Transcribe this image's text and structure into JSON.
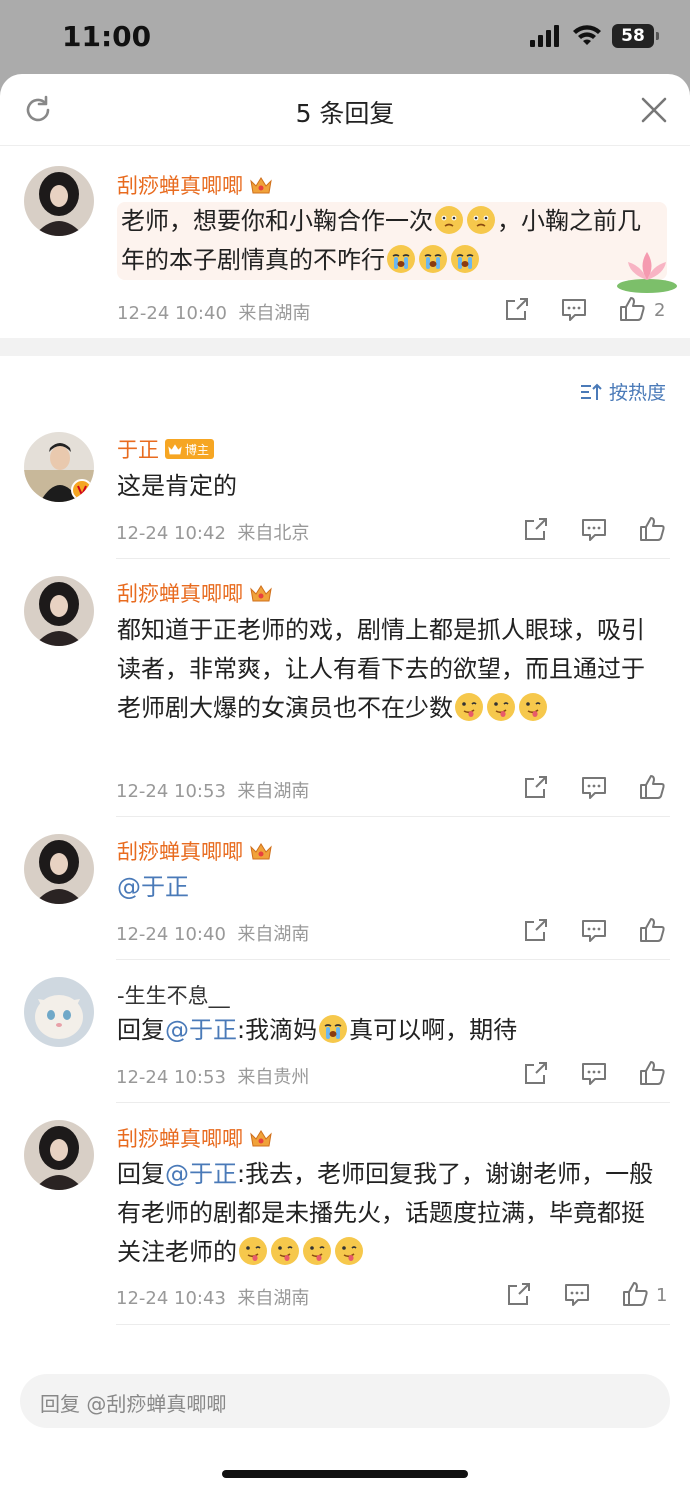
{
  "status": {
    "time": "11:00",
    "battery": "58"
  },
  "sheet": {
    "title": "5 条回复"
  },
  "original": {
    "author": "刮痧蝉真唧唧",
    "text_a": "老师，想要你和小鞠合作一次",
    "text_b": "，小鞠之前几年的本子剧情真的不咋行",
    "time": "12-24 10:40",
    "location": "来自湖南",
    "likes": "2"
  },
  "sort_label": "按热度",
  "replies": [
    {
      "author": "于正",
      "badge": "博主",
      "text": "这是肯定的",
      "time": "12-24 10:42",
      "location": "来自北京"
    },
    {
      "author": "刮痧蝉真唧唧",
      "text": "都知道于正老师的戏，剧情上都是抓人眼球，吸引读者，非常爽，让人有看下去的欲望，而且通过于老师剧大爆的女演员也不在少数",
      "time": "12-24 10:53",
      "location": "来自湖南"
    },
    {
      "author": "刮痧蝉真唧唧",
      "mention": "@于正",
      "time": "12-24 10:40",
      "location": "来自湖南"
    },
    {
      "author": "-生生不息__",
      "prefix": "回复",
      "mention": "@于正",
      "text_a": ":我滴妈",
      "text_b": "真可以啊，期待",
      "time": "12-24 10:53",
      "location": "来自贵州"
    },
    {
      "author": "刮痧蝉真唧唧",
      "prefix": "回复",
      "mention": "@于正",
      "text": ":我去，老师回复我了，谢谢老师，一般有老师的剧都是未播先火，话题度拉满，毕竟都挺关注老师的",
      "time": "12-24 10:43",
      "location": "来自湖南",
      "likes": "1"
    }
  ],
  "reply_input": {
    "placeholder": "回复 @刮痧蝉真唧唧"
  },
  "icons": {
    "refresh": "refresh-icon",
    "close": "close-icon",
    "share": "share-icon",
    "comment": "comment-icon",
    "like": "thumbs-up-icon",
    "crown": "crown-icon",
    "sort": "sort-icon"
  },
  "colors": {
    "username": "#e86b1f",
    "mention": "#4a7ab8",
    "meta": "#999999"
  }
}
